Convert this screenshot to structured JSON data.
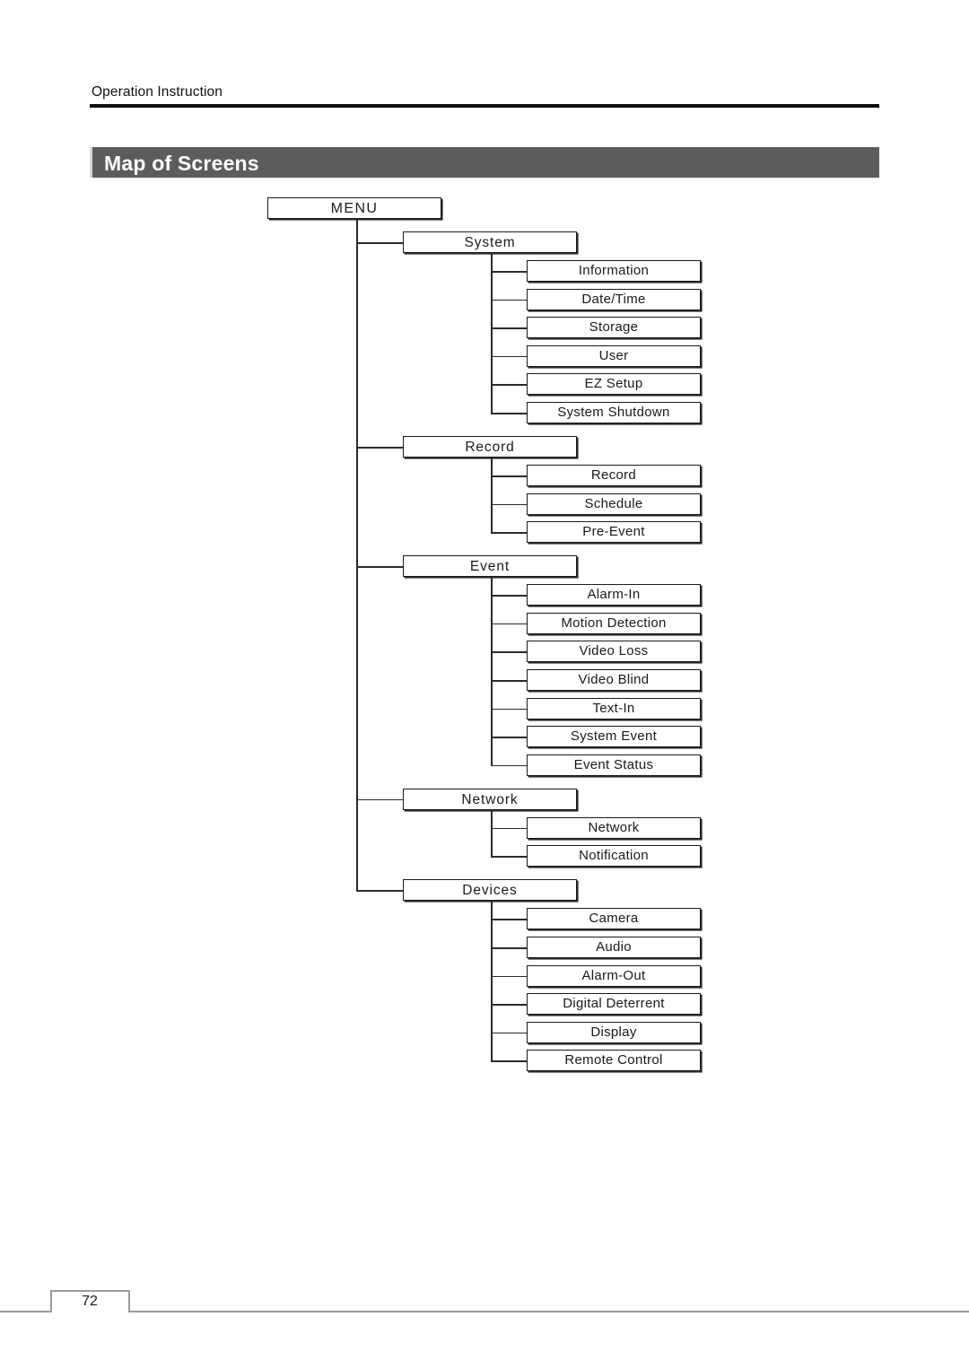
{
  "header": {
    "running_title": "Operation Instruction"
  },
  "banner": {
    "title": "Map of Screens",
    "bg_color": "#5c5c5c",
    "text_color": "#ffffff"
  },
  "footer": {
    "page_number": "72"
  },
  "diagram": {
    "type": "tree",
    "root": "MENU",
    "line_color": "#2b2b2b",
    "box_border_color": "#1a1a1a",
    "groups": [
      {
        "label": "System",
        "children": [
          "Information",
          "Date/Time",
          "Storage",
          "User",
          "EZ Setup",
          "System Shutdown"
        ]
      },
      {
        "label": "Record",
        "children": [
          "Record",
          "Schedule",
          "Pre-Event"
        ]
      },
      {
        "label": "Event",
        "children": [
          "Alarm-In",
          "Motion Detection",
          "Video Loss",
          "Video Blind",
          "Text-In",
          "System Event",
          "Event Status"
        ]
      },
      {
        "label": "Network",
        "children": [
          "Network",
          "Notification"
        ]
      },
      {
        "label": "Devices",
        "children": [
          "Camera",
          "Audio",
          "Alarm-Out",
          "Digital Deterrent",
          "Display",
          "Remote Control"
        ]
      }
    ]
  }
}
